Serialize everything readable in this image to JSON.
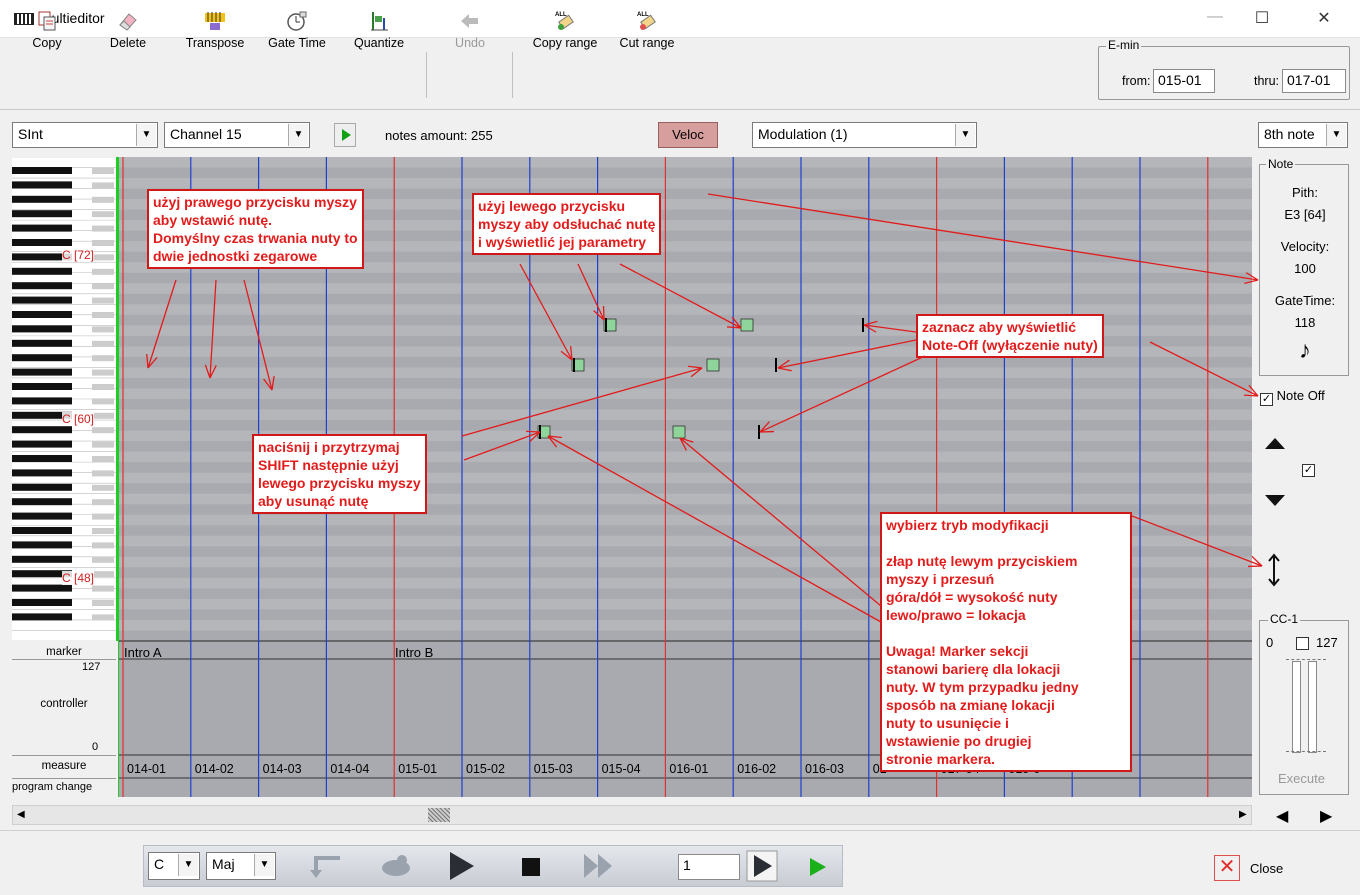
{
  "window": {
    "title": "Multieditor",
    "minimize": "—",
    "maximize": "☐",
    "close": "✕"
  },
  "toolbar": {
    "copy": "Copy",
    "delete": "Delete",
    "transpose": "Transpose",
    "gate_time": "Gate Time",
    "quantize": "Quantize",
    "undo": "Undo",
    "copy_range": "Copy range",
    "cut_range": "Cut range",
    "all_badge": "ALL"
  },
  "emin": {
    "legend": "E-min",
    "from_label": "from:",
    "from_value": "015-01",
    "thru_label": "thru:",
    "thru_value": "017-01"
  },
  "controls": {
    "instrument": "SInt",
    "channel": "Channel 15",
    "notes_amount": "notes amount:  255",
    "veloc": "Veloc",
    "controller": "Modulation (1)",
    "resolution": "8th note"
  },
  "piano": {
    "c72": "C [72]",
    "c60": "C [60]",
    "c48": "C [48]"
  },
  "rows": {
    "marker": "marker",
    "controller": "controller",
    "ctrl_max": "127",
    "ctrl_min": "0",
    "measure": "measure",
    "program_change": "program change"
  },
  "markers": [
    "Intro A",
    "Intro B"
  ],
  "measures": [
    "014-01",
    "014-02",
    "014-03",
    "014-04",
    "015-01",
    "015-02",
    "015-03",
    "015-04",
    "016-01",
    "016-02",
    "016-03",
    "01",
    "017-04",
    "018-0"
  ],
  "note_panel": {
    "legend": "Note",
    "pitch_label": "Pith:",
    "pitch_value": "E3 [64]",
    "velocity_label": "Velocity:",
    "velocity_value": "100",
    "gatetime_label": "GateTime:",
    "gatetime_value": "118",
    "note_icon": "♪",
    "note_off_label": "Note Off",
    "note_off_checked": true
  },
  "cc_panel": {
    "legend": "CC-1",
    "min": "0",
    "max": "127",
    "execute": "Execute"
  },
  "bottom": {
    "key": "C",
    "scale": "Maj",
    "measure_value": "1",
    "close": "Close"
  },
  "annotations": {
    "right_click": [
      "użyj prawego przycisku myszy",
      "aby wstawić nutę.",
      "Domyślny czas trwania nuty to",
      "dwie jednostki zegarowe"
    ],
    "left_click": [
      "użyj lewego przycisku",
      "myszy aby odsłuchać nutę",
      "i wyświetlić jej parametry"
    ],
    "note_off": [
      "zaznacz aby wyświetlić",
      "Note-Off (wyłączenie nuty)"
    ],
    "shift_delete": [
      "naciśnij i przytrzymaj",
      "SHIFT następnie użyj",
      "lewego przycisku myszy",
      "aby usunąć nutę"
    ],
    "modify_mode": [
      "wybierz tryb modyfikacji",
      "",
      "złap nutę lewym przyciskiem",
      "myszy i przesuń",
      "góra/dół = wysokość nuty",
      "lewo/prawo = lokacja",
      "",
      "Uwaga! Marker sekcji",
      "stanowi barierę dla lokacji",
      "nuty. W tym przypadku jedny",
      "sposób na zmianę lokacji",
      "nuty to usunięcie i",
      "wstawienie po drugiej",
      "stronie markera."
    ]
  },
  "colors": {
    "grid_bg": "#a9aaaf",
    "measure_line": "#e03030",
    "beat_line": "#1f3fd0",
    "note_fill": "#8fd49a",
    "annotation": "#e21b1b",
    "playhead": "#1fcf1f"
  }
}
